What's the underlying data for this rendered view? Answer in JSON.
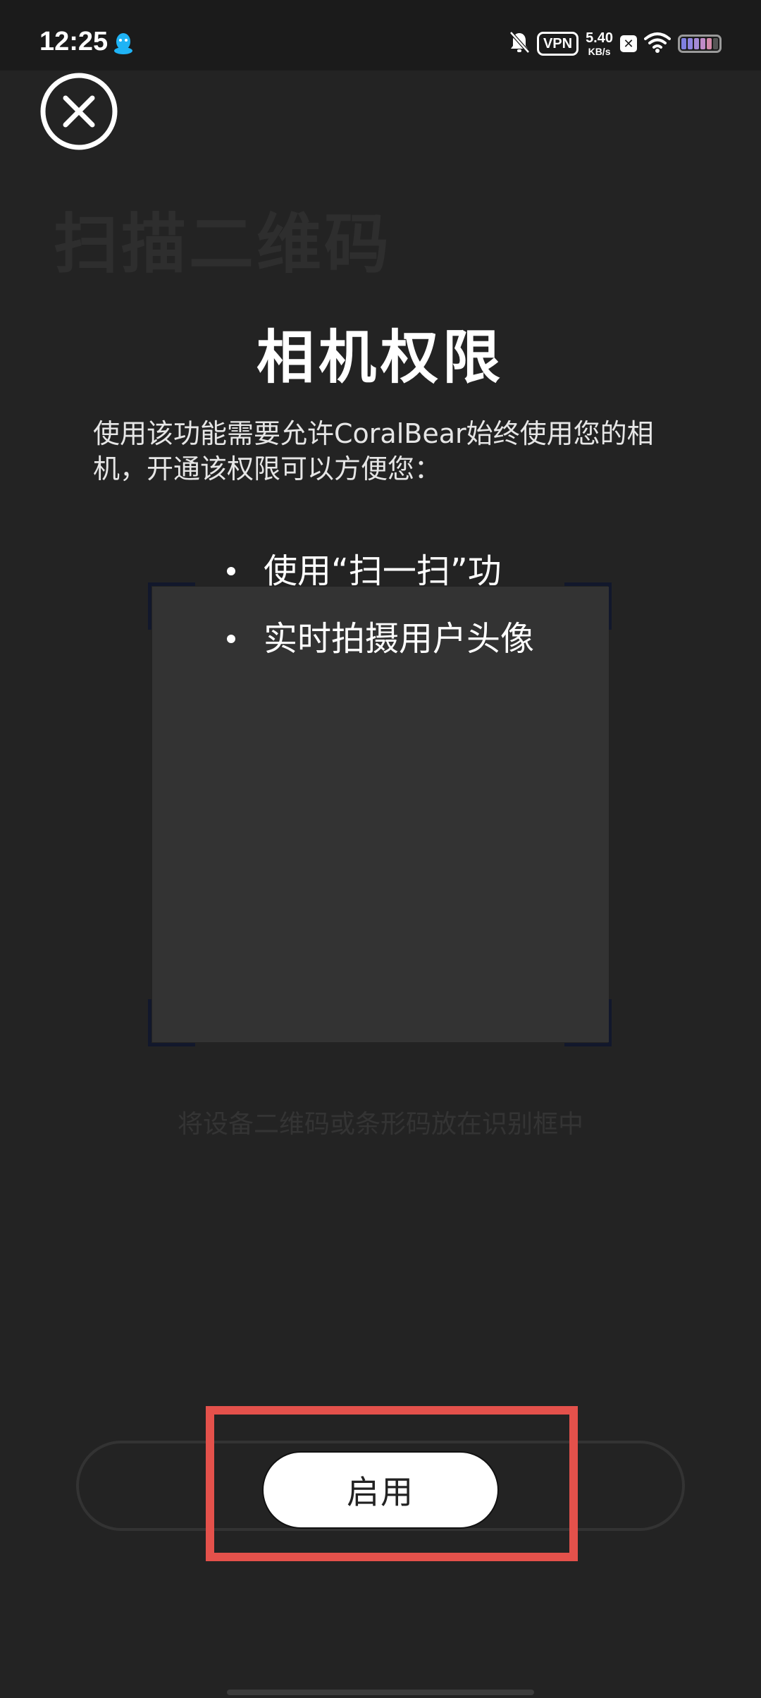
{
  "status_bar": {
    "time": "12:25",
    "vpn": "VPN",
    "net_speed_value": "5.40",
    "net_speed_unit": "KB/s"
  },
  "background": {
    "title": "扫描二维码",
    "scan_hint": "将设备二维码或条形码放在识别框中"
  },
  "dialog": {
    "title": "相机权限",
    "description": "使用该功能需要允许CoralBear始终使用您的相机，开通该权限可以方便您：",
    "features": [
      "使用“扫一扫”功",
      "实时拍摄用户头像"
    ],
    "enable_label": "启用"
  },
  "colors": {
    "background": "#232323",
    "highlight": "#e4514b",
    "button": "#ffffff"
  }
}
